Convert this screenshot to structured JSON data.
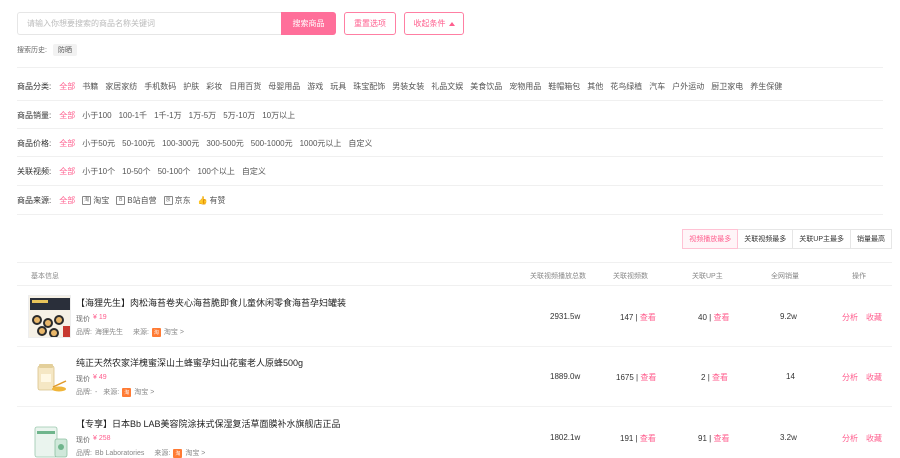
{
  "search": {
    "placeholder": "请输入你想要搜索的商品名称关键词",
    "button": "搜索商品",
    "reset": "重置选项",
    "collapse": "收起条件"
  },
  "history": {
    "label": "搜索历史:",
    "tags": [
      "防晒"
    ]
  },
  "filters": {
    "category": {
      "label": "商品分类:",
      "options": [
        "全部",
        "书籍",
        "家居家纺",
        "手机数码",
        "护肤",
        "彩妆",
        "日用百货",
        "母婴用品",
        "游戏",
        "玩具",
        "珠宝配饰",
        "男装女装",
        "礼品文娱",
        "美食饮品",
        "宠物用品",
        "鞋帽箱包",
        "其他",
        "花鸟绿植",
        "汽车",
        "户外运动",
        "厨卫家电",
        "养生保健"
      ]
    },
    "sales": {
      "label": "商品销量:",
      "options": [
        "全部",
        "小于100",
        "100-1千",
        "1千-1万",
        "1万-5万",
        "5万-10万",
        "10万以上"
      ]
    },
    "price": {
      "label": "商品价格:",
      "options": [
        "全部",
        "小于50元",
        "50-100元",
        "100-300元",
        "300-500元",
        "500-1000元",
        "1000元以上",
        "自定义"
      ]
    },
    "videos": {
      "label": "关联视频:",
      "options": [
        "全部",
        "小于10个",
        "10-50个",
        "50-100个",
        "100个以上",
        "自定义"
      ]
    },
    "source": {
      "label": "商品来源:",
      "options": [
        {
          "text": "全部",
          "icon": ""
        },
        {
          "text": "淘宝",
          "icon": "taobao-icon"
        },
        {
          "text": "B站自营",
          "icon": "bilibili-icon"
        },
        {
          "text": "京东",
          "icon": "jd-icon"
        },
        {
          "text": "有赞",
          "icon": "youzan-icon"
        }
      ]
    }
  },
  "sort_tabs": [
    "视频播放最多",
    "关联视频最多",
    "关联UP主最多",
    "销量最高"
  ],
  "table": {
    "headers": {
      "basic": "基本信息",
      "plays": "关联视频播放总数",
      "video_count": "关联视频数",
      "up_count": "关联UP主",
      "sales": "全网销量",
      "actions": "操作"
    },
    "rows": [
      {
        "title": "【海狸先生】肉松海苔卷夹心海苔脆即食儿童休闲零食海苔孕妇罐装",
        "price_label": "现价",
        "price": "¥ 19",
        "brand_label": "品牌:",
        "brand": "海狸先生",
        "source_label": "来源:",
        "source": "淘宝 >",
        "plays": "2931.5w",
        "video_count": "147",
        "up_count": "40",
        "view": "查看",
        "sales": "9.2w",
        "analyze": "分析",
        "favorite": "收藏"
      },
      {
        "title": "纯正天然农家洋槐蜜深山土蜂蜜孕妇山花蜜老人原蜂500g",
        "price_label": "现价",
        "price": "¥ 49",
        "brand_label": "品牌:",
        "brand": "-",
        "source_label": "来源:",
        "source": "淘宝 >",
        "plays": "1889.0w",
        "video_count": "1675",
        "up_count": "2",
        "view": "查看",
        "sales": "14",
        "analyze": "分析",
        "favorite": "收藏"
      },
      {
        "title": "【专享】日本Bb LAB美容院涂抹式保湿复活草面膜补水旗舰店正品",
        "price_label": "现价",
        "price": "¥ 258",
        "brand_label": "品牌:",
        "brand": "Bb Laboratories",
        "source_label": "来源:",
        "source": "淘宝 >",
        "plays": "1802.1w",
        "video_count": "191",
        "up_count": "91",
        "view": "查看",
        "sales": "3.2w",
        "analyze": "分析",
        "favorite": "收藏"
      }
    ]
  },
  "colors": {
    "accent": "#ff6f9a",
    "accent_text": "#ff5e8e",
    "taobao": "#ff7a33"
  }
}
